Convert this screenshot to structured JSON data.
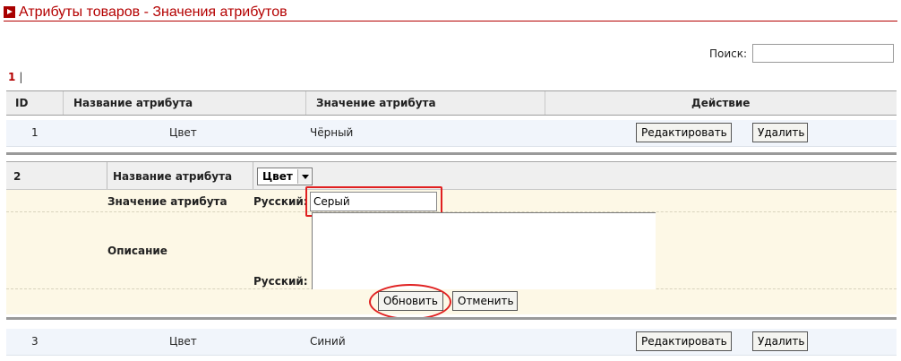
{
  "page": {
    "title": "Атрибуты товаров - Значения атрибутов"
  },
  "search": {
    "label": "Поиск:",
    "value": ""
  },
  "pager": {
    "current": "1",
    "separator": "|"
  },
  "table": {
    "columns": [
      "ID",
      "Название атрибута",
      "Значение атрибута",
      "Действие"
    ]
  },
  "rows": [
    {
      "id": "1",
      "attribute": "Цвет",
      "value": "Чёрный",
      "edit_label": "Редактировать",
      "delete_label": "Удалить"
    },
    {
      "id": "3",
      "attribute": "Цвет",
      "value": "Синий",
      "edit_label": "Редактировать",
      "delete_label": "Удалить"
    }
  ],
  "edit_form": {
    "id": "2",
    "attribute_label": "Название атрибута",
    "attribute_select_value": "Цвет",
    "value_label": "Значение атрибута",
    "value_lang_label": "Русский:",
    "value_input": "Серый",
    "description_label": "Описание",
    "description_lang_label": "Русский:",
    "description_value": "",
    "update_label": "Обновить",
    "cancel_label": "Отменить"
  },
  "colors": {
    "brand": "#b40000",
    "highlight": "#e02020",
    "row_bg": "#f1f5fb",
    "form_bg": "#fdf8e6"
  }
}
